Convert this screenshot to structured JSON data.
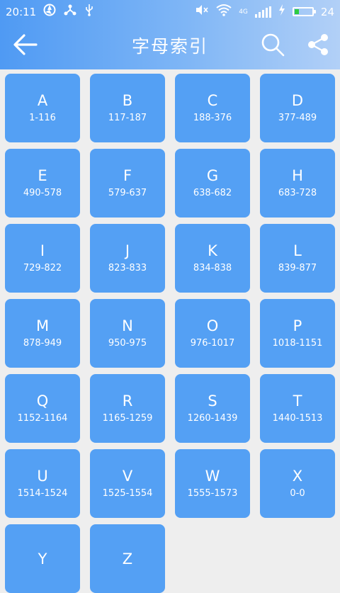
{
  "status_bar": {
    "time": "20:11",
    "network_label": "4G",
    "battery_level": "24",
    "battery_fraction": 0.24
  },
  "app_bar": {
    "title": "字母索引"
  },
  "index_tiles": [
    {
      "letter": "A",
      "range": "1-116"
    },
    {
      "letter": "B",
      "range": "117-187"
    },
    {
      "letter": "C",
      "range": "188-376"
    },
    {
      "letter": "D",
      "range": "377-489"
    },
    {
      "letter": "E",
      "range": "490-578"
    },
    {
      "letter": "F",
      "range": "579-637"
    },
    {
      "letter": "G",
      "range": "638-682"
    },
    {
      "letter": "H",
      "range": "683-728"
    },
    {
      "letter": "I",
      "range": "729-822"
    },
    {
      "letter": "J",
      "range": "823-833"
    },
    {
      "letter": "K",
      "range": "834-838"
    },
    {
      "letter": "L",
      "range": "839-877"
    },
    {
      "letter": "M",
      "range": "878-949"
    },
    {
      "letter": "N",
      "range": "950-975"
    },
    {
      "letter": "O",
      "range": "976-1017"
    },
    {
      "letter": "P",
      "range": "1018-1151"
    },
    {
      "letter": "Q",
      "range": "1152-1164"
    },
    {
      "letter": "R",
      "range": "1165-1259"
    },
    {
      "letter": "S",
      "range": "1260-1439"
    },
    {
      "letter": "T",
      "range": "1440-1513"
    },
    {
      "letter": "U",
      "range": "1514-1524"
    },
    {
      "letter": "V",
      "range": "1525-1554"
    },
    {
      "letter": "W",
      "range": "1555-1573"
    },
    {
      "letter": "X",
      "range": "0-0"
    },
    {
      "letter": "Y",
      "range": ""
    },
    {
      "letter": "Z",
      "range": ""
    }
  ]
}
